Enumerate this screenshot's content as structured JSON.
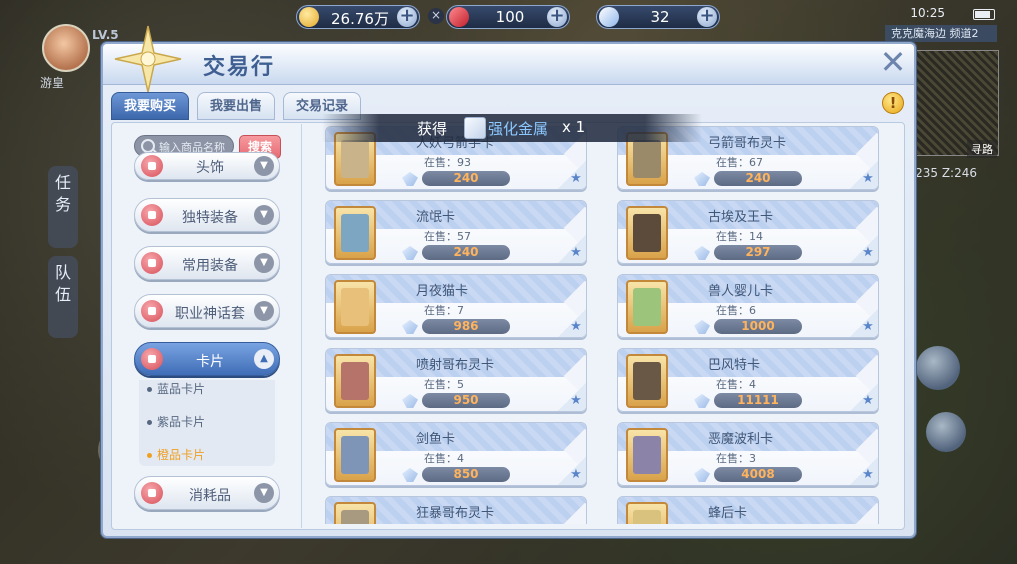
{
  "hud": {
    "player_lv": "LV.5",
    "player_name": "游皇",
    "time": "10:25",
    "zone": "克克魔海边",
    "channel": "频道2",
    "find_path": "寻路",
    "coord": "235 Z:246",
    "side_task": "任务",
    "side_team": "队伍"
  },
  "currency": [
    {
      "name": "zeny",
      "value": "26.76万",
      "color": "#f3c54a"
    },
    {
      "name": "diamond",
      "value": "100",
      "color": "#e0404a"
    },
    {
      "name": "crystal",
      "value": "32",
      "color": "#bcd7f7"
    }
  ],
  "window": {
    "title": "交易行",
    "tabs": [
      {
        "label": "我要购买",
        "active": true
      },
      {
        "label": "我要出售",
        "active": false
      },
      {
        "label": "交易记录",
        "active": false
      }
    ]
  },
  "search": {
    "placeholder": "输入商品名称",
    "button": "搜索"
  },
  "categories": [
    {
      "label": "头饰"
    },
    {
      "label": "独特装备"
    },
    {
      "label": "常用装备"
    },
    {
      "label": "职业神话套"
    },
    {
      "label": "卡片",
      "active": true
    },
    {
      "label": "消耗品"
    }
  ],
  "subcategories": [
    {
      "label": "蓝品卡片"
    },
    {
      "label": "紫品卡片"
    },
    {
      "label": "橙品卡片",
      "active": true
    }
  ],
  "cards": [
    {
      "name": "人妖弓箭手卡",
      "stock": "在售：93",
      "price": "240"
    },
    {
      "name": "弓箭哥布灵卡",
      "stock": "在售：67",
      "price": "240"
    },
    {
      "name": "流氓卡",
      "stock": "在售：57",
      "price": "240"
    },
    {
      "name": "古埃及王卡",
      "stock": "在售：14",
      "price": "297"
    },
    {
      "name": "月夜猫卡",
      "stock": "在售：7",
      "price": "986"
    },
    {
      "name": "兽人婴儿卡",
      "stock": "在售：6",
      "price": "1000"
    },
    {
      "name": "喷射哥布灵卡",
      "stock": "在售：5",
      "price": "950"
    },
    {
      "name": "巴风特卡",
      "stock": "在售：4",
      "price": "11111"
    },
    {
      "name": "剑鱼卡",
      "stock": "在售：4",
      "price": "850"
    },
    {
      "name": "恶魔波利卡",
      "stock": "在售：3",
      "price": "4008"
    },
    {
      "name": "狂暴哥布灵卡",
      "stock": "",
      "price": ""
    },
    {
      "name": "蜂后卡",
      "stock": "",
      "price": ""
    }
  ],
  "toast": {
    "prefix": "获得",
    "item": "强化金属",
    "qty": "x 1"
  }
}
